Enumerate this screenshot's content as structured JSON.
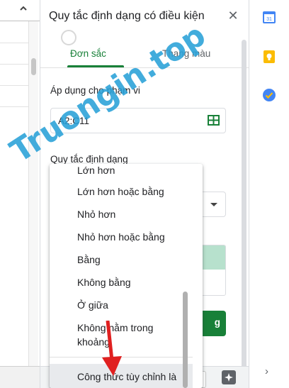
{
  "sheet": {
    "collapse_glyph": "❮"
  },
  "panel": {
    "title": "Quy tắc định dạng có điều kiện",
    "close_glyph": "✕",
    "tabs": [
      {
        "label": "Đơn sắc",
        "active": true
      },
      {
        "label": "Thang màu",
        "active": false
      }
    ],
    "apply_range_label": "Áp dụng cho phạm vi",
    "range_value": "A2:C11",
    "format_rules_label": "Quy tắc định dạng",
    "done_button_label": "g",
    "accent_color": "#188038",
    "preview_fill_color": "#b7e1cd"
  },
  "menu": {
    "items": [
      {
        "label": "Lớn hơn"
      },
      {
        "label": "Lớn hơn hoặc bằng"
      },
      {
        "label": "Nhỏ hơn"
      },
      {
        "label": "Nhỏ hơn hoặc bằng"
      },
      {
        "label": "Bằng"
      },
      {
        "label": "Không bằng"
      },
      {
        "label": "Ở giữa"
      },
      {
        "label": "Không nằm trong khoảng"
      }
    ],
    "highlighted_item": "Công thức tùy chỉnh là",
    "highlight_color": "#e8eaed"
  },
  "rail": {
    "icons": [
      "calendar-icon",
      "keep-icon",
      "tasks-icon"
    ],
    "calendar_day": "31",
    "chevron_glyph": "›"
  },
  "watermark": {
    "text": "Truongin.top"
  }
}
